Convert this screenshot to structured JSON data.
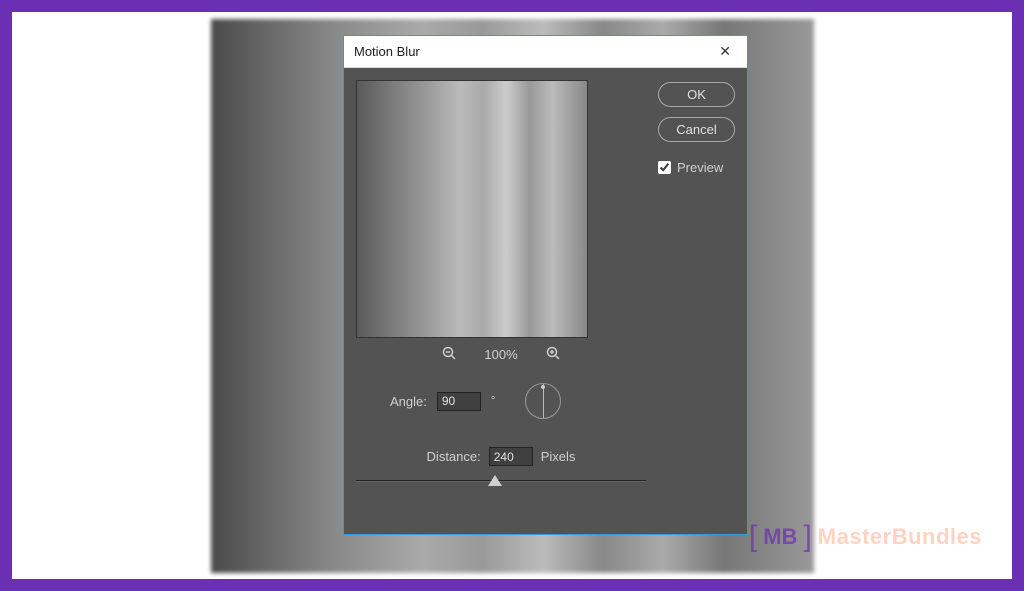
{
  "dialog": {
    "title": "Motion Blur",
    "buttons": {
      "ok": "OK",
      "cancel": "Cancel"
    },
    "preview_label": "Preview",
    "preview_checked": true,
    "zoom": {
      "level": "100%"
    },
    "angle": {
      "label": "Angle:",
      "value": "90",
      "unit": "°"
    },
    "distance": {
      "label": "Distance:",
      "value": "240",
      "unit": "Pixels"
    }
  },
  "watermark": {
    "logo_short": "MB",
    "text": "MasterBundles"
  }
}
